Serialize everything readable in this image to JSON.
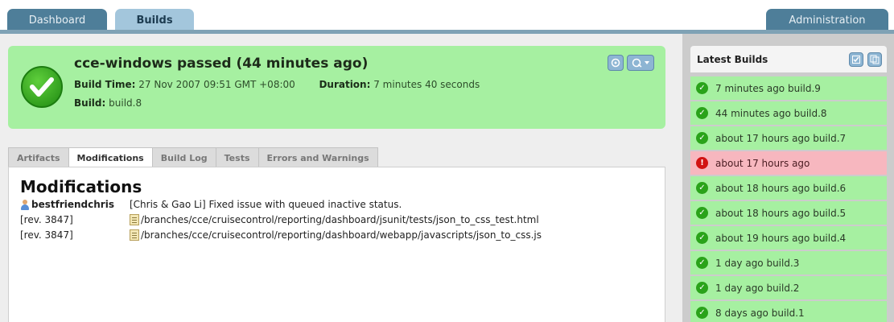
{
  "nav": {
    "tabs": [
      {
        "label": "Dashboard"
      },
      {
        "label": "Builds"
      },
      {
        "label": "Administration"
      }
    ]
  },
  "status": {
    "title": "cce-windows passed (44 minutes ago)",
    "build_time_label": "Build Time:",
    "build_time": "27 Nov 2007 09:51 GMT +08:00",
    "duration_label": "Duration:",
    "duration": "7 minutes 40 seconds",
    "build_label": "Build:",
    "build": "build.8",
    "icon": "check-icon"
  },
  "detail_tabs": [
    {
      "label": "Artifacts"
    },
    {
      "label": "Modifications"
    },
    {
      "label": "Build Log"
    },
    {
      "label": "Tests"
    },
    {
      "label": "Errors and Warnings"
    }
  ],
  "modifications": {
    "heading": "Modifications",
    "rows": [
      {
        "left": "bestfriendchris",
        "right": "[Chris & Gao Li] Fixed issue with queued inactive status."
      },
      {
        "left": "[rev. 3847]",
        "right": "/branches/cce/cruisecontrol/reporting/dashboard/jsunit/tests/json_to_css_test.html"
      },
      {
        "left": "[rev. 3847]",
        "right": "/branches/cce/cruisecontrol/reporting/dashboard/webapp/javascripts/json_to_css.js"
      }
    ]
  },
  "latest_builds": {
    "title": "Latest Builds",
    "items": [
      {
        "label": "7 minutes ago build.9",
        "status": "passed"
      },
      {
        "label": "44 minutes ago build.8",
        "status": "passed"
      },
      {
        "label": "about 17 hours ago build.7",
        "status": "passed"
      },
      {
        "label": "about 17 hours ago",
        "status": "failed"
      },
      {
        "label": "about 18 hours ago build.6",
        "status": "passed"
      },
      {
        "label": "about 18 hours ago build.5",
        "status": "passed"
      },
      {
        "label": "about 19 hours ago build.4",
        "status": "passed"
      },
      {
        "label": "1 day ago build.3",
        "status": "passed"
      },
      {
        "label": "1 day ago build.2",
        "status": "passed"
      },
      {
        "label": "8 days ago build.1",
        "status": "passed"
      }
    ]
  },
  "colors": {
    "passed": "#a6f0a1",
    "failed": "#f7b7bf",
    "nav_active": "#a3c6dc",
    "nav_inactive": "#4e7e99"
  }
}
